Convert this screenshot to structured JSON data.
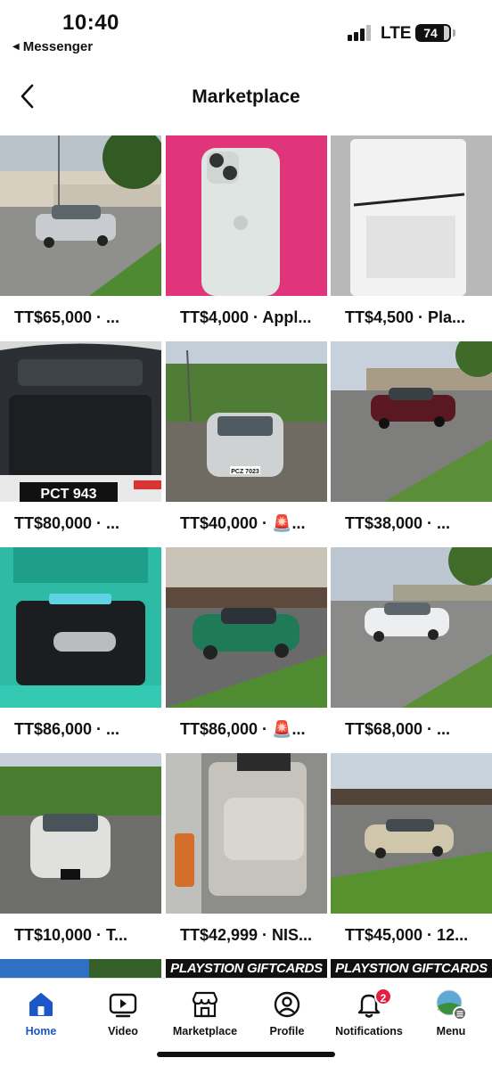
{
  "status_bar": {
    "time": "10:40",
    "back_app": "Messenger",
    "network": "LTE",
    "battery": "74"
  },
  "header": {
    "title": "Marketplace"
  },
  "listings": [
    {
      "price": "TT$65,000 · ..."
    },
    {
      "price": "TT$4,000 · Appl..."
    },
    {
      "price": "TT$4,500 · Pla..."
    },
    {
      "price": "TT$80,000 · ..."
    },
    {
      "price": "TT$40,000 · 🚨..."
    },
    {
      "price": "TT$38,000 · ..."
    },
    {
      "price": "TT$86,000 · ..."
    },
    {
      "price": "TT$86,000 · 🚨..."
    },
    {
      "price": "TT$68,000 · ..."
    },
    {
      "price": "TT$10,000 · T..."
    },
    {
      "price": "TT$42,999 · NIS..."
    },
    {
      "price": "TT$45,000 · 12..."
    }
  ],
  "photo_text": {
    "plate_1": "PCT 943",
    "plate_2": "PCZ 7023"
  },
  "partial_row": {
    "gift_1": "PLAYSTION GIFTCARDS",
    "gift_2": "PLAYSTION GIFTCARDS"
  },
  "tabs": [
    {
      "label": "Home",
      "icon": "home-icon"
    },
    {
      "label": "Video",
      "icon": "video-icon"
    },
    {
      "label": "Marketplace",
      "icon": "marketplace-icon"
    },
    {
      "label": "Profile",
      "icon": "profile-icon"
    },
    {
      "label": "Notifications",
      "icon": "bell-icon",
      "badge": "2"
    },
    {
      "label": "Menu",
      "icon": "menu-avatar-icon"
    }
  ],
  "colors": {
    "accent": "#1b57c9",
    "badge": "#e41e3f"
  }
}
